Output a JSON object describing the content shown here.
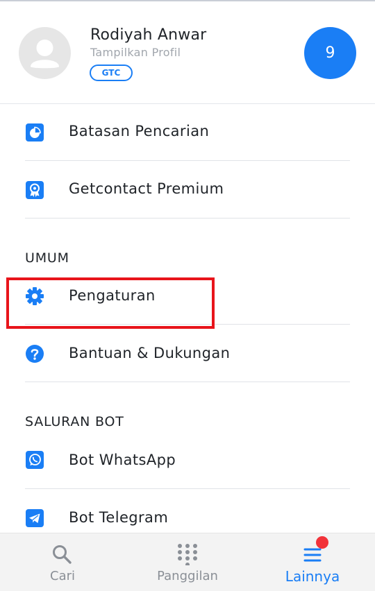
{
  "profile": {
    "name": "Rodiyah Anwar",
    "subtitle": "Tampilkan Profil",
    "badge": "GTC",
    "counter": "9"
  },
  "menu": {
    "items": [
      {
        "label": "Batasan Pencarian",
        "icon": "pie-chart-icon"
      },
      {
        "label": "Getcontact Premium",
        "icon": "premium-badge-icon"
      }
    ],
    "sections": [
      {
        "title": "UMUM",
        "items": [
          {
            "label": "Pengaturan",
            "icon": "gear-icon"
          },
          {
            "label": "Bantuan & Dukungan",
            "icon": "help-icon"
          }
        ]
      },
      {
        "title": "SALURAN BOT",
        "items": [
          {
            "label": "Bot WhatsApp",
            "icon": "whatsapp-icon"
          },
          {
            "label": "Bot Telegram",
            "icon": "telegram-icon"
          }
        ]
      }
    ]
  },
  "bottom_nav": {
    "items": [
      {
        "label": "Cari",
        "icon": "search-icon"
      },
      {
        "label": "Panggilan",
        "icon": "dialpad-icon"
      },
      {
        "label": "Lainnya",
        "icon": "menu-icon",
        "active": true
      }
    ]
  },
  "colors": {
    "accent": "#1a7ef5",
    "highlight": "#e8141b",
    "notification": "#f2333a"
  }
}
